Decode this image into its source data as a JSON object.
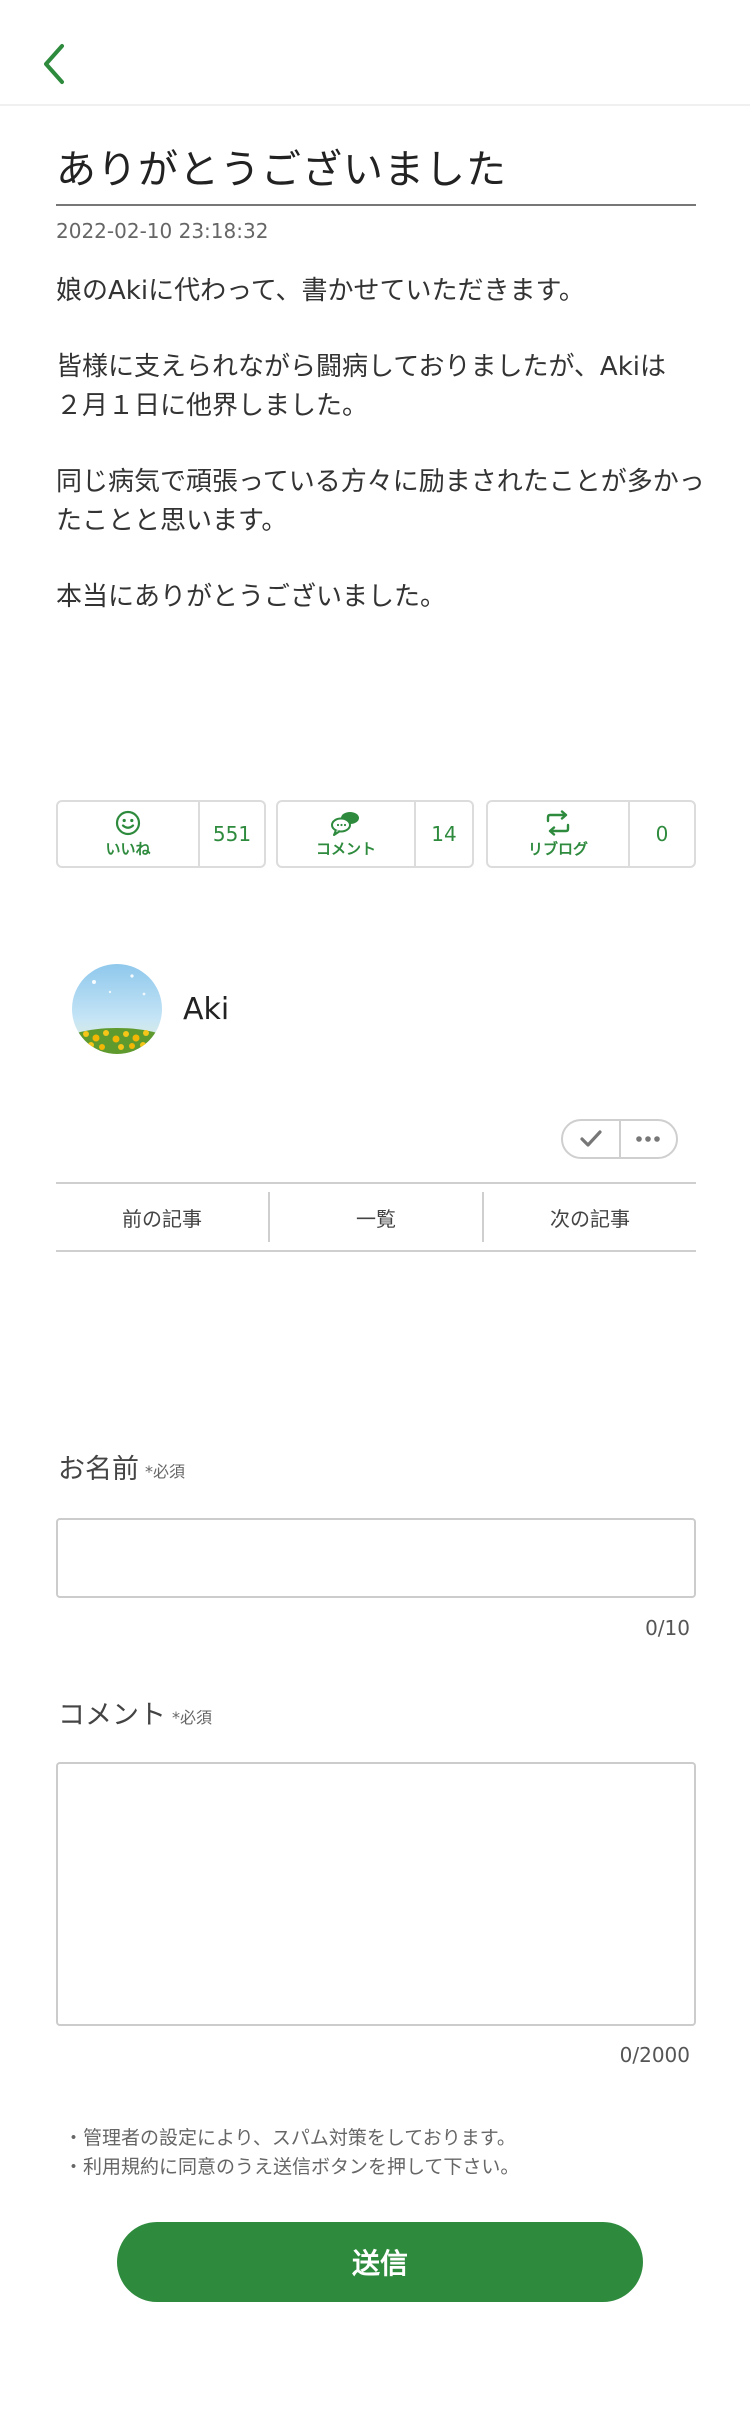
{
  "colors": {
    "accent": "#2e8b3e",
    "border": "#dcdcdc",
    "text": "#333333"
  },
  "header": {
    "back_icon": "chevron-left-icon"
  },
  "article": {
    "title": "ありがとうございました",
    "date": "2022-02-10 23:18:32",
    "paragraphs": [
      "娘のAkiに代わって、書かせていただきます。",
      "皆様に支えられながら闘病しておりましたが、Akiは\n２月１日に他界しました。",
      "同じ病気で頑張っている方々に励まされたことが多かっ\nたことと思います。",
      "本当にありがとうございました。"
    ]
  },
  "reactions": {
    "like": {
      "icon": "smile-icon",
      "label": "いいね",
      "count": "551"
    },
    "comment": {
      "icon": "speech-bubbles-icon",
      "label": "コメント",
      "count": "14"
    },
    "reblog": {
      "icon": "repeat-icon",
      "label": "リブログ",
      "count": "0"
    }
  },
  "profile": {
    "name": "Aki",
    "avatar": "sunflower-field-avatar"
  },
  "actions": {
    "check_icon": "check-icon",
    "more_icon": "more-dots-icon"
  },
  "nav": {
    "prev": "前の記事",
    "list": "一覧",
    "next": "次の記事"
  },
  "form": {
    "name_label": "お名前",
    "name_required": "*必須",
    "name_value": "",
    "name_counter": "0/10",
    "comment_label": "コメント",
    "comment_required": "*必須",
    "comment_value": "",
    "comment_counter": "0/2000",
    "notes": [
      "・管理者の設定により、スパム対策をしております。",
      "・利用規約に同意のうえ送信ボタンを押して下さい。"
    ],
    "submit_label": "送信"
  }
}
